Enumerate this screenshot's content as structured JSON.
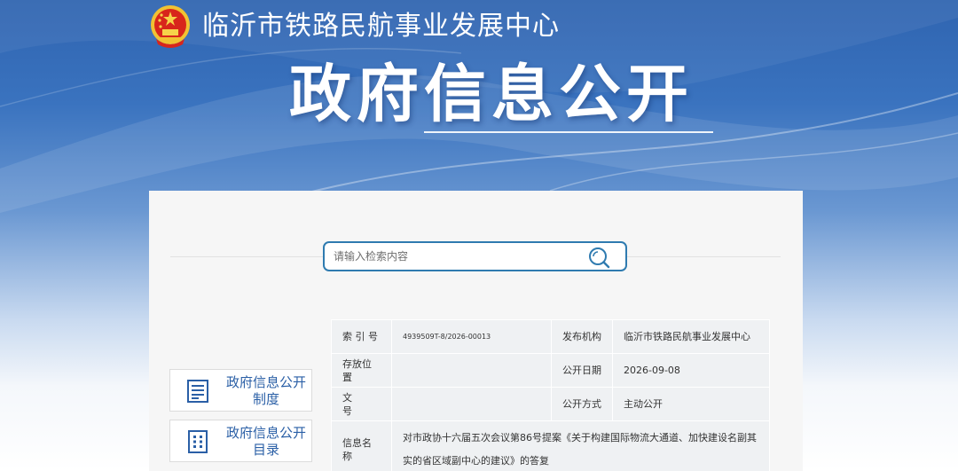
{
  "header": {
    "org_name": "临沂市铁路民航事业发展中心",
    "banner_title": "政府信息公开"
  },
  "search": {
    "placeholder": "请输入检索内容"
  },
  "sidebar": {
    "items": [
      {
        "label": "政府信息公开制度",
        "icon": "list-document-icon"
      },
      {
        "label": "政府信息公开目录",
        "icon": "grid-document-icon"
      }
    ]
  },
  "info": {
    "index_label": "索 引 号",
    "index_value": "4939509T-8/2026-00013",
    "publisher_label": "发布机构",
    "publisher_value": "临沂市铁路民航事业发展中心",
    "location_label": "存放位置",
    "location_value": "",
    "date_label": "公开日期",
    "date_value": "2026-09-08",
    "docno_label": "文　　号",
    "docno_value": "",
    "method_label": "公开方式",
    "method_value": "主动公开",
    "name_label": "信息名称",
    "name_value": "对市政协十六届五次会议第86号提案《关于构建国际物流大通道、加快建设名副其实的省区域副中心的建议》的答复"
  },
  "colors": {
    "banner_blue": "#2f64b0",
    "accent_blue": "#2a5fa6",
    "search_border": "#2f7bb0"
  }
}
